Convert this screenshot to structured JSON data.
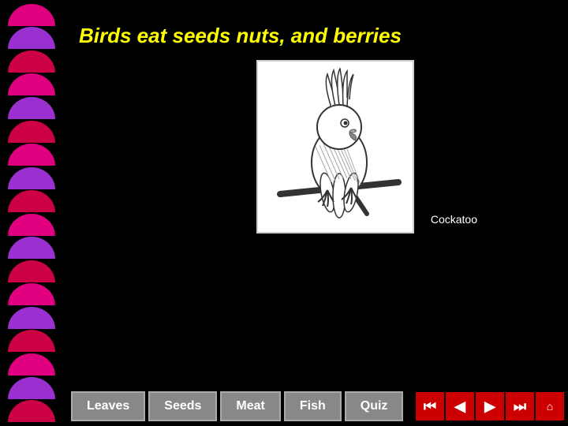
{
  "page": {
    "title": "Birds eat seeds nuts, and berries",
    "background_color": "#000000"
  },
  "bird": {
    "name": "Cockatoo",
    "label": "Cockatoo"
  },
  "navigation": {
    "buttons": [
      {
        "id": "leaves",
        "label": "Leaves"
      },
      {
        "id": "seeds",
        "label": "Seeds"
      },
      {
        "id": "meat",
        "label": "Meat"
      },
      {
        "id": "fish",
        "label": "Fish"
      },
      {
        "id": "quiz",
        "label": "Quiz"
      }
    ],
    "arrows": [
      {
        "id": "first",
        "icon": "⏮",
        "label": "First"
      },
      {
        "id": "prev",
        "icon": "◀",
        "label": "Previous"
      },
      {
        "id": "next",
        "icon": "▶",
        "label": "Next"
      },
      {
        "id": "last",
        "icon": "⏭",
        "label": "Last"
      },
      {
        "id": "home",
        "icon": "⌂",
        "label": "Home"
      }
    ]
  },
  "decorative": {
    "fan_colors": [
      "#e0007f",
      "#9b30d0",
      "#cc0044",
      "#e0007f",
      "#9b30d0",
      "#cc0044",
      "#e0007f",
      "#9b30d0",
      "#cc0044",
      "#e0007f",
      "#9b30d0",
      "#cc0044",
      "#e0007f",
      "#9b30d0",
      "#cc0044",
      "#e0007f",
      "#9b30d0",
      "#cc0044"
    ]
  }
}
